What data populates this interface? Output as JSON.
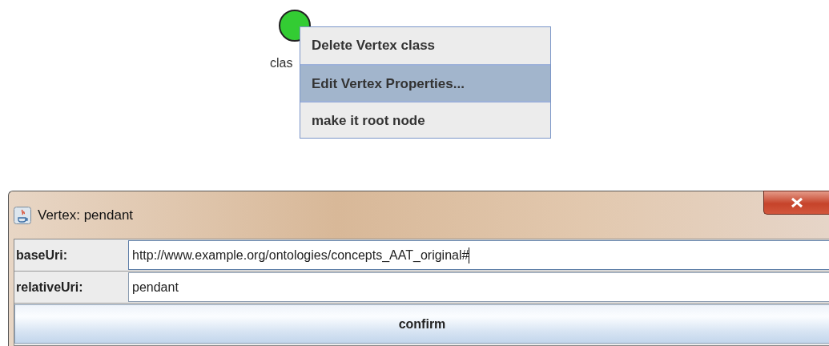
{
  "graph": {
    "vertex": {
      "label": "clas",
      "color": "#33cc33"
    }
  },
  "context_menu": {
    "items": [
      {
        "label": "Delete Vertex class",
        "selected": false
      },
      {
        "label": "Edit Vertex Properties...",
        "selected": true
      },
      {
        "label": "make it root node",
        "selected": false
      }
    ]
  },
  "dialog": {
    "title": "Vertex: pendant",
    "fields": [
      {
        "label": "baseUri:",
        "value": "http://www.example.org/ontologies/concepts_AAT_original#",
        "focused": true
      },
      {
        "label": "relativeUri:",
        "value": "pendant",
        "focused": false
      }
    ],
    "button": "confirm"
  }
}
